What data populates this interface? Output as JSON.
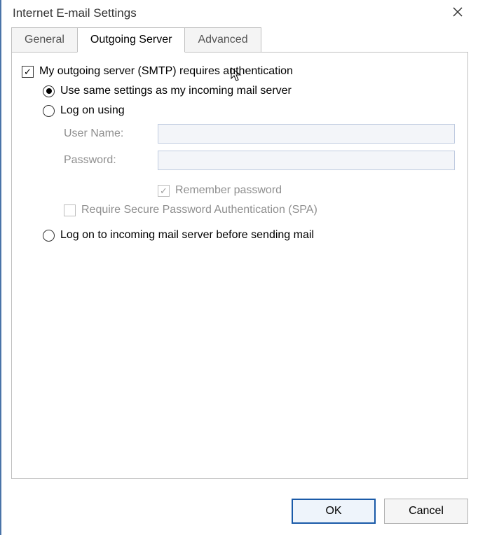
{
  "title": "Internet E-mail Settings",
  "tabs": {
    "general": "General",
    "outgoing": "Outgoing Server",
    "advanced": "Advanced"
  },
  "form": {
    "requires_auth": "My outgoing server (SMTP) requires authentication",
    "use_same": "Use same settings as my incoming mail server",
    "log_on_using": "Log on using",
    "username_label": "User Name:",
    "username_value": "",
    "password_label": "Password:",
    "password_value": "",
    "remember_password": "Remember password",
    "require_spa": "Require Secure Password Authentication (SPA)",
    "log_on_incoming": "Log on to incoming mail server before sending mail"
  },
  "buttons": {
    "ok": "OK",
    "cancel": "Cancel"
  }
}
